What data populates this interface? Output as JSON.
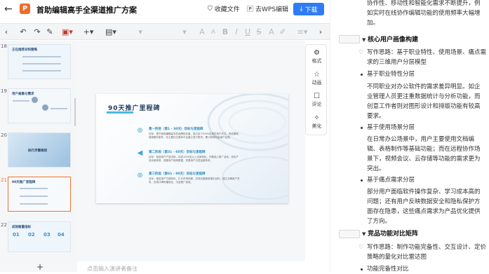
{
  "titlebar": {
    "app_icon": "P",
    "doc_title": "首助编辑高手全渠道推广方案",
    "favorite": "收藏文件",
    "wps_edit": "去WPS编辑",
    "download": "下载"
  },
  "toolbar": {
    "font_size_up": "A",
    "font_size_down": "A",
    "bold": "B",
    "italic": "I",
    "underline": "U",
    "strike": "S",
    "font_color": "A"
  },
  "thumbnails": [
    {
      "num": "18",
      "title": "正在推荐对和策略"
    },
    {
      "num": "19",
      "title": "用户画像与需求"
    },
    {
      "num": "20",
      "title": "执行步骤规划"
    },
    {
      "num": "21",
      "title": "90天推广里程碑"
    },
    {
      "num": "22",
      "title": "成效衡量指标"
    }
  ],
  "thumb22_nums": [
    "01",
    "02",
    "03",
    "04"
  ],
  "slide": {
    "title": "90天推广里程碑",
    "phases": [
      {
        "head": "第一阶段（第1 - 30天）目标与里程碑",
        "desc": "目标：提升首助编辑高手的品牌知名度，吸引至少5000名潜在用户关注，完成基础营销素材制作，在主要社交媒体平台建立官方账号，累计获得初始用户反馈。"
      },
      {
        "head": "第二阶段（第31 - 60天）目标与里程碑",
        "desc": "目标：促进用户产品试用，实现1000名以上试用转化，开展线上推广活动，优化产品功能体验，收集用户使用数据，完善用户分层运营体系。"
      },
      {
        "head": "第三阶段（第61 - 90天）目标与里程碑",
        "desc": "目标：推进用户付费转化，扩大市场份额，实现月度营收增长目标，建立长期用户关系，形成口碑传播效应，沉淀推广经验。"
      }
    ]
  },
  "notes_placeholder": "点击输入演讲者备注",
  "add_slide": "+",
  "rail": [
    {
      "icon": "gear-icon",
      "glyph": "⚙",
      "label": "格式"
    },
    {
      "icon": "animation-icon",
      "glyph": "☆",
      "label": "动画"
    },
    {
      "icon": "comment-icon",
      "glyph": "☐",
      "label": "评论"
    },
    {
      "icon": "beautify-icon",
      "glyph": "✧",
      "label": "美化"
    }
  ],
  "right": {
    "intro_lines": [
      "协作性、移动性和智能化需求不断提升，例",
      "如实时在线协作编辑功能的使用频率大幅增",
      "加。"
    ],
    "sec1_title": "核心用户画像构建",
    "sec1_tip_lines": [
      "写作思路：基于职业特性、使用场景、痛点需",
      "求的三维用户分层模型"
    ],
    "sec1_items": [
      {
        "title": "基于职业特性分层",
        "lines": [
          "不同职业对办公软件的需求差异明显。如企",
          "业管理人员更注重数据统计与分析功能，而",
          "创意工作者则对图形设计和排版功能有较高",
          "要求。"
        ]
      },
      {
        "title": "基于使用场景分层",
        "lines": [
          "在日常办公场景中，用户主要使用文档编",
          "辑、表格制作等基础功能；而在远程协作场",
          "景下，视频会议、云存储等功能的需求更为",
          "突出。"
        ]
      },
      {
        "title": "基于痛点需求分层",
        "lines": [
          "部分用户面临软件操作复杂、学习成本高的",
          "问题；还有用户反映数据安全和隐私保护方",
          "面存在隐患，这些痛点需求为产品优化提供",
          "了方向。"
        ]
      }
    ],
    "sec2_title": "竞品功能对比矩阵",
    "sec2_tip_lines": [
      "写作思路：制作功能完备性、交互设计、定价",
      "策略的量化对比雷达图"
    ],
    "sec2_item": "功能完备性对比"
  }
}
